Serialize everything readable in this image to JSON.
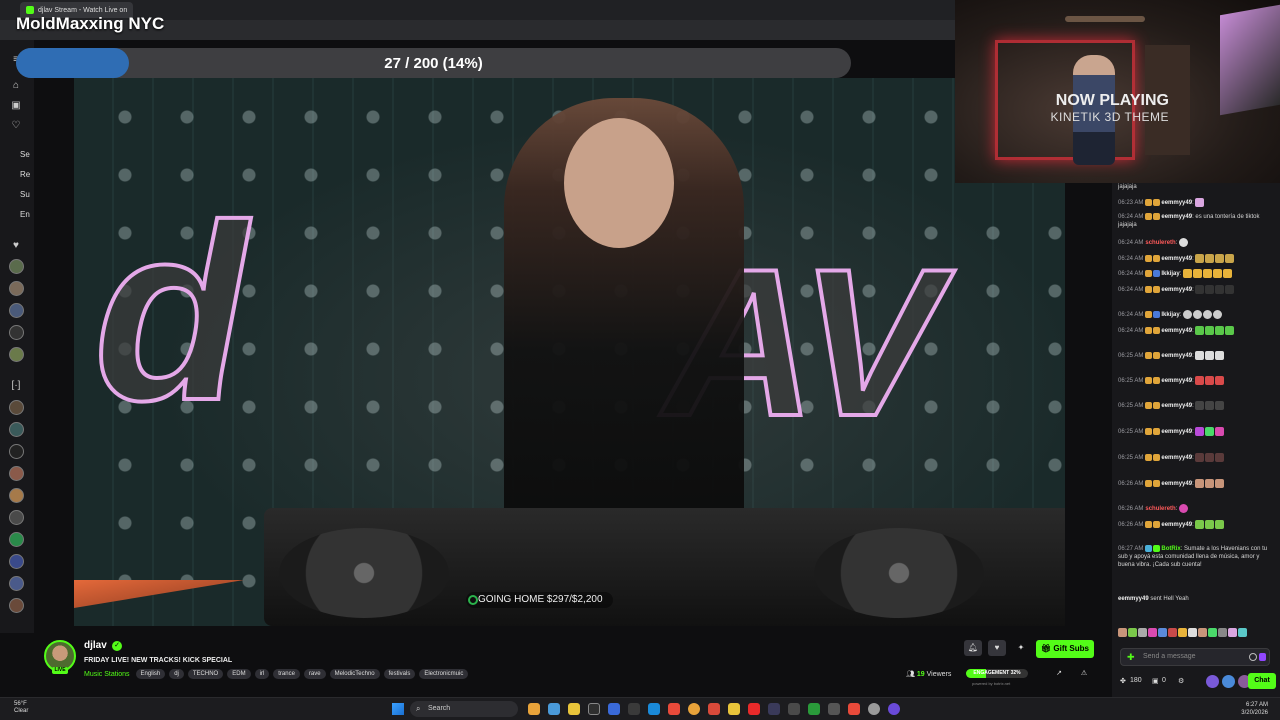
{
  "browser": {
    "tab_title": "djlav Stream - Watch Live on"
  },
  "stream_title": "MoldMaxxing NYC",
  "progress": {
    "label": "27 / 200 (14%)",
    "fraction": 0.135
  },
  "sidebar": {
    "labels": [
      "Se",
      "Re",
      "Su",
      "En"
    ]
  },
  "video": {
    "now_playing_title": "NOW PLAYING",
    "now_playing_subtitle": "KINETIK 3D THEME",
    "goal_text": "GOING HOME  $297/$2,200"
  },
  "chat": {
    "top_line": "jajajaja",
    "messages": [
      {
        "time": "06:23 AM",
        "user": "eemmyy49",
        "text": ""
      },
      {
        "time": "06:24 AM",
        "user": "eemmyy49",
        "text": "es una tontería de tiktok jajajaja"
      },
      {
        "time": "06:24 AM",
        "user": "schulereth",
        "text": ""
      },
      {
        "time": "06:24 AM",
        "user": "eemmyy49",
        "text": ""
      },
      {
        "time": "06:24 AM",
        "user": "lkkijay",
        "text": ""
      },
      {
        "time": "06:24 AM",
        "user": "eemmyy49",
        "text": ""
      },
      {
        "time": "06:24 AM",
        "user": "lkkijay",
        "text": ""
      },
      {
        "time": "06:24 AM",
        "user": "eemmyy49",
        "text": ""
      },
      {
        "time": "06:25 AM",
        "user": "eemmyy49",
        "text": ""
      },
      {
        "time": "06:25 AM",
        "user": "eemmyy49",
        "text": ""
      },
      {
        "time": "06:25 AM",
        "user": "eemmyy49",
        "text": ""
      },
      {
        "time": "06:25 AM",
        "user": "eemmyy49",
        "text": ""
      },
      {
        "time": "06:25 AM",
        "user": "eemmyy49",
        "text": ""
      },
      {
        "time": "06:26 AM",
        "user": "eemmyy49",
        "text": ""
      },
      {
        "time": "06:26 AM",
        "user": "schulereth",
        "text": ""
      },
      {
        "time": "06:26 AM",
        "user": "eemmyy49",
        "text": ""
      },
      {
        "time": "06:27 AM",
        "user": "BotRix",
        "text": "Sumate a los Havenians con tu sub y apoyá esta comunidad llena de música, amor y buena vibra. ¡Cada sub cuenta!"
      }
    ],
    "sub_notice_user": "eemmyy49",
    "sub_notice_text": "sent Hell Yeah",
    "input_placeholder": "Send a message",
    "points": "180",
    "count": "0",
    "chat_button": "Chat"
  },
  "channel": {
    "name": "djlav",
    "live_badge": "LIVE",
    "description": "FRIDAY LIVE! NEW TRACKS! KICK SPECIAL",
    "category": "Music Stations",
    "tags": [
      "English",
      "dj",
      "TECHNO",
      "EDM",
      "irl",
      "trance",
      "rave",
      "MelodicTechno",
      "festivals",
      "Electronicmuic"
    ],
    "viewers_count": "19",
    "viewers_label": "Viewers",
    "engagement_label": "ENGAGEMENT 32%",
    "engagement_fraction": 0.32,
    "powered_by": "powered by botrix.net",
    "gift_button": "Gift Subs"
  },
  "taskbar": {
    "weather_temp": "56°F",
    "weather_desc": "Clear",
    "search_placeholder": "Search",
    "time": "6:27 AM",
    "date": "3/20/2026"
  },
  "colors": {
    "kick_green": "#53fc18",
    "progress_blue": "#2f6db4",
    "logo_pink": "#e4a8e8"
  }
}
